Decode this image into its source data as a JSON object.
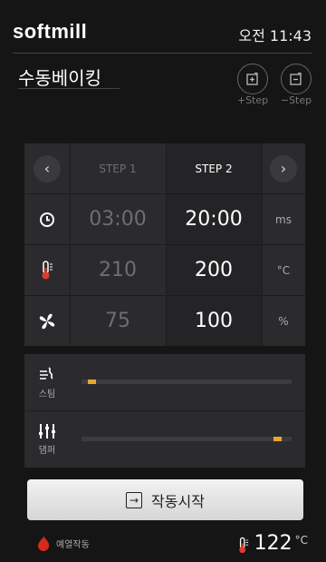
{
  "header": {
    "brand": "softmill",
    "time": "오전 11:43"
  },
  "page_title": "수동베이킹",
  "step_buttons": {
    "add_label": "+Step",
    "remove_label": "−Step"
  },
  "steps": {
    "headers": [
      "STEP 1",
      "STEP 2"
    ],
    "time": {
      "values": [
        "03:00",
        "20:00"
      ],
      "unit": "ms"
    },
    "temperature": {
      "values": [
        "210",
        "200"
      ],
      "unit": "°C"
    },
    "fan": {
      "values": [
        "75",
        "100"
      ],
      "unit": "%"
    }
  },
  "sliders": {
    "steam": {
      "label": "스팀",
      "level": 0.03
    },
    "damper": {
      "label": "댐퍼",
      "level": 0.95
    }
  },
  "start_button": {
    "label": "작동시작"
  },
  "footer": {
    "preheat_label": "예열작동",
    "temperature": "122",
    "unit": "°C"
  },
  "colors": {
    "accent": "#e8a531",
    "flame": "#d42b1e",
    "background": "#151515",
    "panel": "#2b2b2d"
  }
}
